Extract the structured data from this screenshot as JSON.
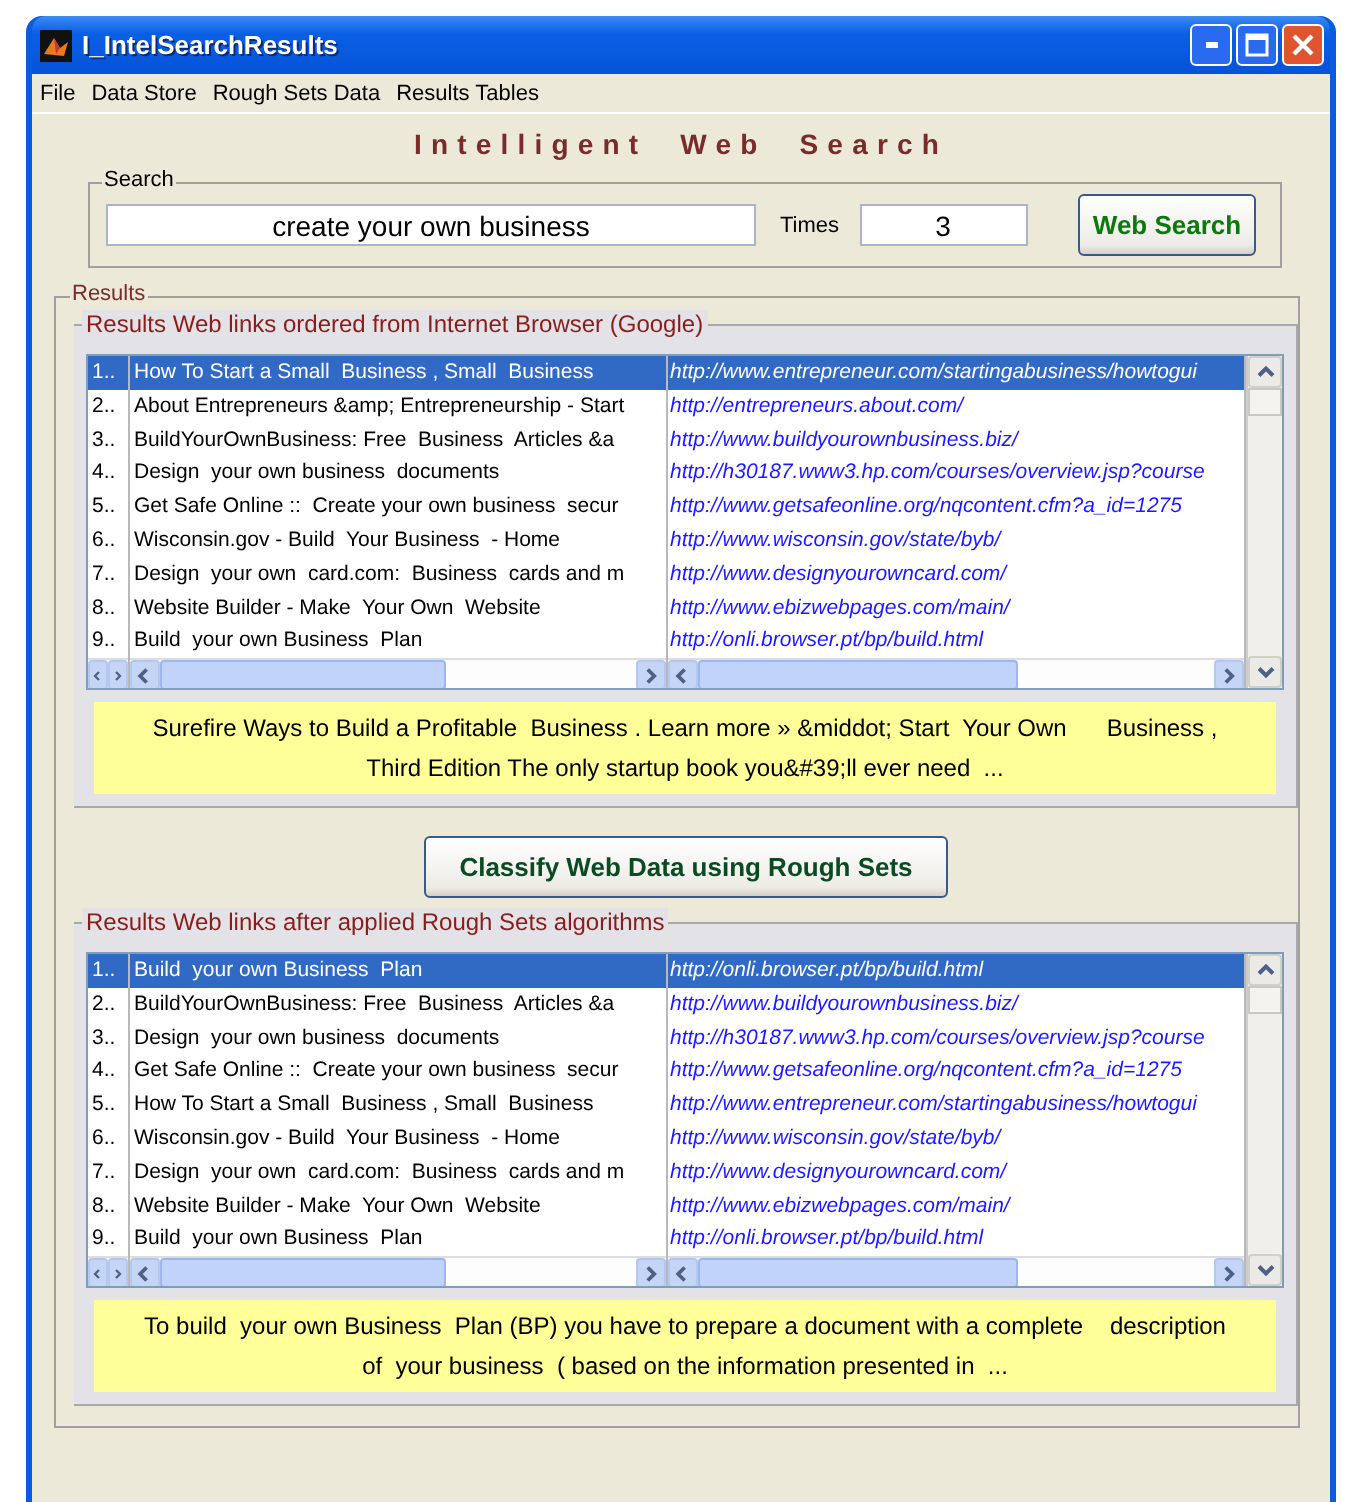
{
  "window": {
    "title": "I_IntelSearchResults"
  },
  "menu": [
    "File",
    "Data Store",
    "Rough Sets Data",
    "Results Tables"
  ],
  "heading": "Intelligent Web Search",
  "search": {
    "label": "Search",
    "query": "create your own business",
    "times_label": "Times",
    "times": "3",
    "button": "Web Search"
  },
  "results": {
    "label": "Results",
    "classify_button": "Classify Web Data using Rough Sets",
    "panels": [
      {
        "title": "Results Web links ordered from Internet Browser (Google)",
        "rows": [
          {
            "index": "1..",
            "title": "How To Start a Small  Business , Small  Business",
            "url": "http://www.entrepreneur.com/startingabusiness/howtogui",
            "selected": true
          },
          {
            "index": "2..",
            "title": "About Entrepreneurs &amp; Entrepreneurship - Start",
            "url": "http://entrepreneurs.about.com/",
            "selected": false
          },
          {
            "index": "3..",
            "title": "BuildYourOwnBusiness: Free  Business  Articles &a",
            "url": "http://www.buildyourownbusiness.biz/",
            "selected": false
          },
          {
            "index": "4..",
            "title": "Design  your own business  documents",
            "url": "http://h30187.www3.hp.com/courses/overview.jsp?course",
            "selected": false
          },
          {
            "index": "5..",
            "title": "Get Safe Online ::  Create your own business  secur",
            "url": "http://www.getsafeonline.org/nqcontent.cfm?a_id=1275",
            "selected": false
          },
          {
            "index": "6..",
            "title": "Wisconsin.gov - Build  Your Business  - Home",
            "url": "http://www.wisconsin.gov/state/byb/",
            "selected": false
          },
          {
            "index": "7..",
            "title": "Design  your own  card.com:  Business  cards and m",
            "url": "http://www.designyourowncard.com/",
            "selected": false
          },
          {
            "index": "8..",
            "title": "Website Builder - Make  Your Own  Website",
            "url": "http://www.ebizwebpages.com/main/",
            "selected": false
          },
          {
            "index": "9..",
            "title": "Build  your own Business  Plan",
            "url": "http://onli.browser.pt/bp/build.html",
            "selected": false
          }
        ],
        "description": "Surefire Ways to Build a Profitable  Business . Learn more » &middot; Start  Your Own      Business , Third Edition The only startup book you&#39;ll ever need  ..."
      },
      {
        "title": "Results Web links after applied Rough Sets algorithms",
        "rows": [
          {
            "index": "1..",
            "title": "Build  your own Business  Plan",
            "url": "http://onli.browser.pt/bp/build.html",
            "selected": true
          },
          {
            "index": "2..",
            "title": "BuildYourOwnBusiness: Free  Business  Articles &a",
            "url": "http://www.buildyourownbusiness.biz/",
            "selected": false
          },
          {
            "index": "3..",
            "title": "Design  your own business  documents",
            "url": "http://h30187.www3.hp.com/courses/overview.jsp?course",
            "selected": false
          },
          {
            "index": "4..",
            "title": "Get Safe Online ::  Create your own business  secur",
            "url": "http://www.getsafeonline.org/nqcontent.cfm?a_id=1275",
            "selected": false
          },
          {
            "index": "5..",
            "title": "How To Start a Small  Business , Small  Business",
            "url": "http://www.entrepreneur.com/startingabusiness/howtogui",
            "selected": false
          },
          {
            "index": "6..",
            "title": "Wisconsin.gov - Build  Your Business  - Home",
            "url": "http://www.wisconsin.gov/state/byb/",
            "selected": false
          },
          {
            "index": "7..",
            "title": "Design  your own  card.com:  Business  cards and m",
            "url": "http://www.designyourowncard.com/",
            "selected": false
          },
          {
            "index": "8..",
            "title": "Website Builder - Make  Your Own  Website",
            "url": "http://www.ebizwebpages.com/main/",
            "selected": false
          },
          {
            "index": "9..",
            "title": "Build  your own Business  Plan",
            "url": "http://onli.browser.pt/bp/build.html",
            "selected": false
          }
        ],
        "description": "To build  your own Business  Plan (BP) you have to prepare a document with a complete    description of  your business  ( based on the information presented in  ..."
      }
    ]
  }
}
